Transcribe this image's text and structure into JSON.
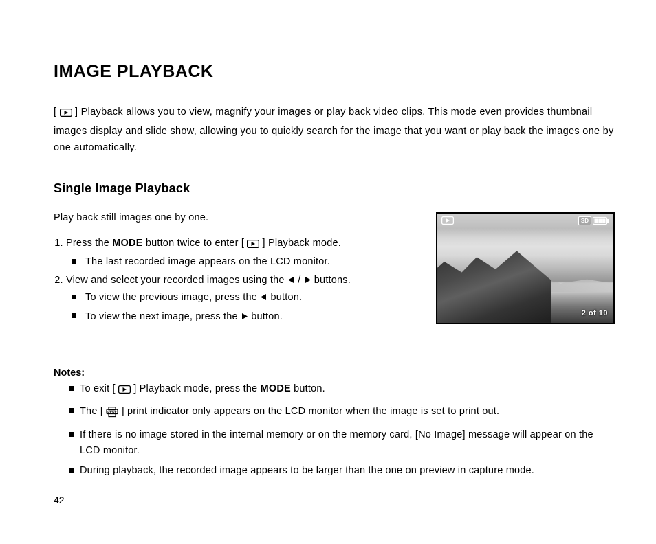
{
  "title": "IMAGE PLAYBACK",
  "intro": "Playback allows you to view, magnify your images or play back video clips. This mode even provides thumbnail images display and slide show, allowing you to quickly search for the image that you want or play back the images one by one automatically.",
  "section_title": "Single Image Playback",
  "lead": "Play back still images one by one.",
  "steps": {
    "s1_a": "Press the ",
    "s1_bold": "MODE",
    "s1_b": " button twice to enter [ ",
    "s1_c": " ] Playback mode.",
    "s1_sub1": "The last recorded image appears on the LCD monitor.",
    "s2_a": "View and select your recorded images using the ",
    "s2_b": " buttons.",
    "s2_sub1_a": "To view the previous image, press the ",
    "s2_sub1_b": " button.",
    "s2_sub2_a": "To view the next image, press the ",
    "s2_sub2_b": " button."
  },
  "notes_label": "Notes:",
  "notes": {
    "n1_a": "To exit [ ",
    "n1_b": " ] Playback mode, press the ",
    "n1_bold": "MODE",
    "n1_c": " button.",
    "n2_a": "The [ ",
    "n2_b": " ] print indicator only appears on the LCD monitor when the image is set to print out.",
    "n3": "If there is no image stored in the internal memory or on the memory card, [No Image] message will appear on the LCD monitor.",
    "n4": "During playback, the recorded image appears to be larger than the one on preview in capture mode."
  },
  "lcd": {
    "sd_label": "SD",
    "counter": "2 of 10"
  },
  "page_number": "42"
}
